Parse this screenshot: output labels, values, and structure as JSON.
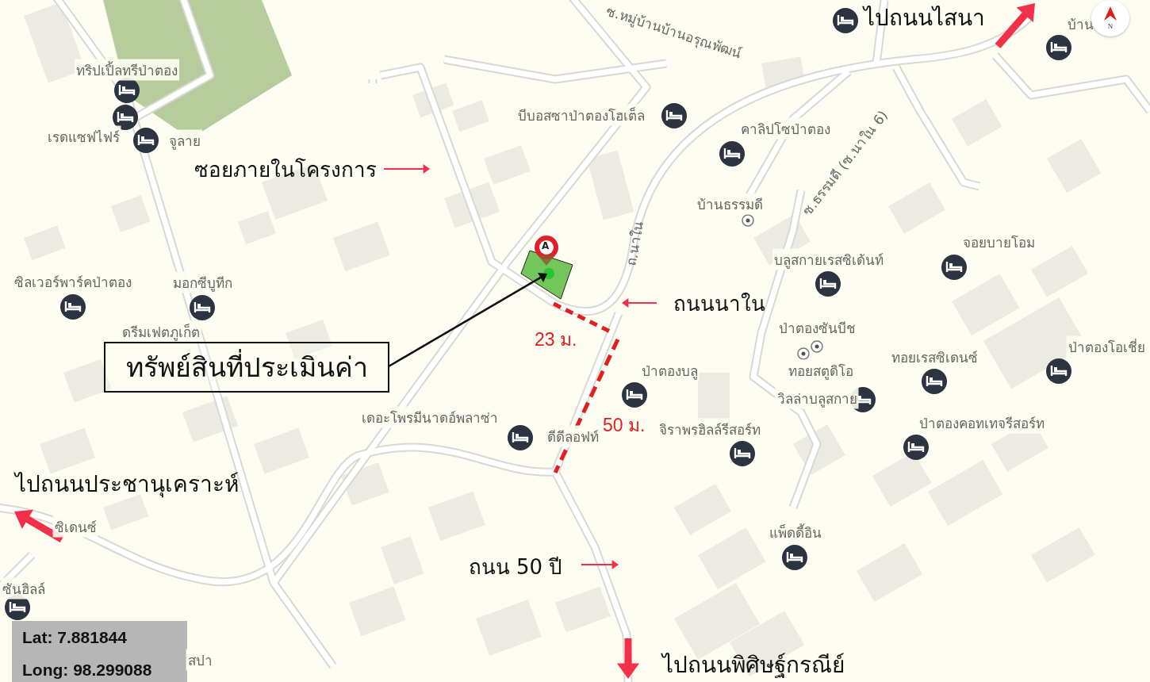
{
  "map": {
    "pois": [
      {
        "label": "ทริปเปิ้ลทรีป่าตอง",
        "kind": "hotel"
      },
      {
        "kind": "hotel"
      },
      {
        "label": "เรดแซฟไฟร์",
        "kind": "hotel"
      },
      {
        "label": "จูลาย"
      },
      {
        "label": "ซิลเวอร์พาร์คป่าตอง",
        "kind": "hotel"
      },
      {
        "label": "มอกซีบูทีก",
        "kind": "hotel"
      },
      {
        "label": "ดรีมเฟตภูเก็ต"
      },
      {
        "label": "บีบอสซาป่าตองโฮเต็ล",
        "kind": "hotel"
      },
      {
        "label": "คาลิปโซป่าตอง",
        "kind": "hotel"
      },
      {
        "label": "บ้านธรรมดี",
        "kind": "place"
      },
      {
        "label": "บลูสกายเรสซิเด้นท์",
        "kind": "hotel"
      },
      {
        "label": "จอยบายโอม",
        "kind": "hotel"
      },
      {
        "label": "ป่าตองซันบีช",
        "kind": "place"
      },
      {
        "kind": "place"
      },
      {
        "label": "ทอยสตูดิโอ"
      },
      {
        "label": "ทอยเรสซิเดนซ์",
        "kind": "hotel"
      },
      {
        "label": "ป่าตองโอเชี่ย",
        "kind": "hotel"
      },
      {
        "label": "ป่าตองบลู",
        "kind": "hotel"
      },
      {
        "label": "วิลล่าบลูสกาย",
        "kind": "hotel"
      },
      {
        "label": "จิราพรฮิลล์รีสอร์ท",
        "kind": "hotel"
      },
      {
        "label": "ป่าตองคอทเทจรีสอร์ท",
        "kind": "hotel"
      },
      {
        "label": "เดอะโพรมีนาดอ์พลาซ่า",
        "kind": "hotel"
      },
      {
        "label": "ดีดีลอฟท์"
      },
      {
        "label": "แพ็ดดี้อิน",
        "kind": "hotel"
      },
      {
        "label": "บ้าน",
        "kind": "hotel"
      },
      {
        "kind": "hotel"
      },
      {
        "label": "ซันฮิลล์",
        "kind": "hotel"
      },
      {
        "label": "สปา"
      },
      {
        "label": "ซิเดนซ์"
      }
    ],
    "road_labels": [
      "ซ.หมู่บ้านบ้านอรุณพัฒน์",
      "ซ.ธรรมดี (ซ.นาใน 6)",
      "ถ.นาใน"
    ],
    "compass": {
      "label": "N"
    }
  },
  "property": {
    "pin_label": "A",
    "caption": "ทรัพย์สินที่ประเมินค่า"
  },
  "distances": [
    "23 ม.",
    "50 ม."
  ],
  "annotations": [
    {
      "text": "ซอยภายในโครงการ",
      "kind": "small"
    },
    {
      "text": "ถนนนาใน",
      "kind": "small"
    },
    {
      "text": "ถนน 50 ปี",
      "kind": "small"
    },
    {
      "text": "ไปถนนไสนา",
      "kind": "big"
    },
    {
      "text": "ไปถนนประชานุเคราะห์",
      "kind": "big"
    },
    {
      "text": "ไปถนนพิศิษฐ์กรณีย์",
      "kind": "big"
    }
  ],
  "coordinates": {
    "lat": "Lat: 7.881844",
    "long": "Long: 98.299088"
  }
}
